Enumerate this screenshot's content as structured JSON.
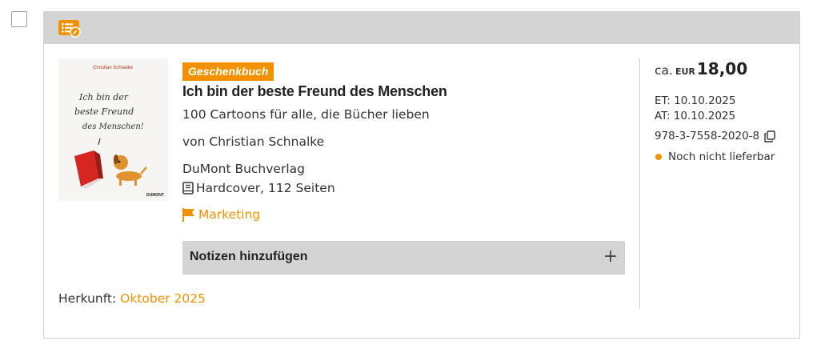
{
  "item": {
    "badge": "Geschenkbuch",
    "title": "Ich bin der beste Freund des Menschen",
    "subtitle": "100 Cartoons für alle, die Bücher lieben",
    "author_line": "von Christian Schnalke",
    "publisher": "DuMont Buchverlag",
    "format": "Hardcover, 112 Seiten",
    "marketing_label": "Marketing",
    "notes_label": "Notizen hinzufügen",
    "origin_label": "Herkunft:",
    "origin_value": "Oktober 2025"
  },
  "cover": {
    "author": "Christian Schnalke",
    "line1": "Ich bin der",
    "line2": "beste Freund",
    "line3": "des Menschen!",
    "publisher_mark": "DUMONT"
  },
  "pricing": {
    "prefix": "ca.",
    "currency": "EUR",
    "value": "18,00",
    "et": "ET: 10.10.2025",
    "at": "AT: 10.10.2025",
    "isbn": "978-3-7558-2020-8",
    "availability": "Noch nicht lieferbar"
  },
  "colors": {
    "accent": "#f39200",
    "header_bg": "#d4d4d4",
    "notes_bg": "#d4d4d4"
  },
  "icons": {
    "header": "list-edit-icon",
    "format": "book-icon",
    "marketing": "flag-icon",
    "notes": "plus-icon",
    "isbn": "copy-icon"
  }
}
